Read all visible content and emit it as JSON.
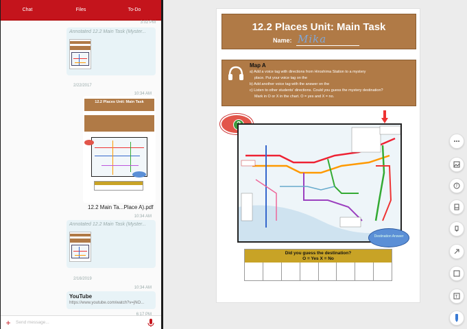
{
  "tabs": [
    {
      "label": "Chat"
    },
    {
      "label": "Files"
    },
    {
      "label": "To-Do"
    }
  ],
  "chat": {
    "messages": [
      {
        "time": "3:02 PM"
      },
      {
        "title": "Annotated 12.2 Main Task (Myster..."
      },
      {
        "date": "2/22/2017",
        "time": "10:34 AM"
      },
      {
        "pdf_name": "12.2 Main Ta...Place A).pdf",
        "time": "10:34 AM"
      },
      {
        "title": "Annotated 12.2 Main Task (Myster..."
      },
      {
        "date": "2/16/2019",
        "time": "10:34 AM"
      },
      {
        "yt_title": "YouTube",
        "yt_url": "https://www.youtube.com/watch?v=jNO...",
        "time": "6:17 PM"
      }
    ],
    "compose_placeholder": "Send message..."
  },
  "document": {
    "title": "12.2 Places Unit: Main Task",
    "name_label": "Name:",
    "name_value": "Mika",
    "task_title": "Map A",
    "task_lines": [
      "a) Add a voice tag with directions from Hiroshima Station to a mystery",
      "place. Put your voice tag on the ",
      "b) Add another voice tag with the answer on the",
      "c) Listen to other students' directions. Could you guess the mystery destination?",
      "Mark in O or X in the chart. O = yes and X = no."
    ],
    "answer_button": "Destination Answer",
    "guess_title": "Did you guess the destination?",
    "guess_legend": "O = Yes     X = No"
  },
  "toolbar": [
    {
      "icon": "more-icon"
    },
    {
      "icon": "image-icon"
    },
    {
      "icon": "voice-tag-icon"
    },
    {
      "icon": "stamp-icon"
    },
    {
      "icon": "marker-icon"
    },
    {
      "icon": "arrow-icon"
    },
    {
      "icon": "rectangle-icon"
    },
    {
      "icon": "text-box-icon"
    },
    {
      "icon": "pen-icon"
    }
  ],
  "colors": {
    "accent": "#c4141c",
    "header_brown": "#b07a46",
    "guess_gold": "#c8a326"
  }
}
